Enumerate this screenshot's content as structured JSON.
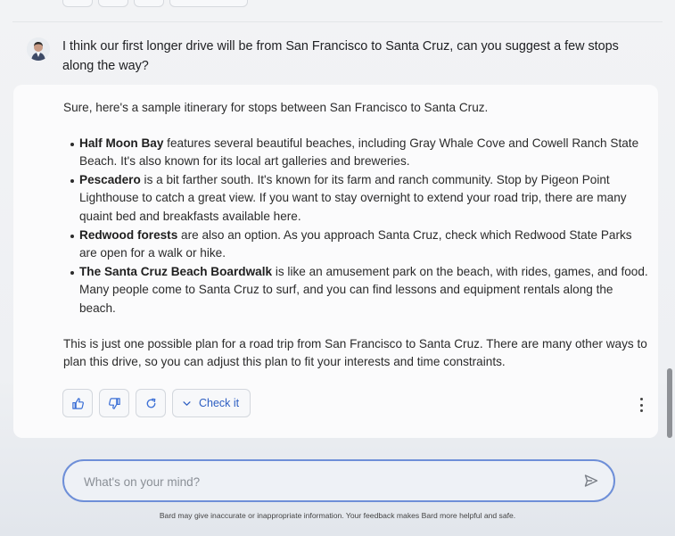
{
  "user_message": {
    "text": "I think our first longer drive will be from San Francisco to Santa Cruz, can you suggest a few stops along the way?"
  },
  "response": {
    "intro": "Sure, here's a sample itinerary for stops between San Francisco to Santa Cruz.",
    "items": [
      {
        "title": "Half Moon Bay",
        "text": " features several beautiful beaches, including Gray Whale Cove and Cowell Ranch State Beach. It's also known for its local art galleries and breweries."
      },
      {
        "title": "Pescadero",
        "text": " is a bit farther south. It's known for its farm and ranch community. Stop by Pigeon Point Lighthouse to catch a great view. If you want to stay overnight to extend your road trip, there are many quaint bed and breakfasts available here."
      },
      {
        "title": "Redwood forests",
        "text": " are also an option. As you approach Santa Cruz, check which Redwood State Parks are open for a walk or hike."
      },
      {
        "title": "The Santa Cruz Beach Boardwalk",
        "text": " is like an amusement park on the beach, with rides, games, and food. Many people come to Santa Cruz to surf, and you can find lessons and equipment rentals along the beach."
      }
    ],
    "outro": "This is just one possible plan for a road trip from San Francisco to Santa Cruz. There are many other ways to plan this drive, so you can adjust this plan to fit your interests and time constraints."
  },
  "actions": {
    "check_label": "Check it",
    "icons": [
      "thumbs-up-icon",
      "thumbs-down-icon",
      "regenerate-icon",
      "chevron-down-icon",
      "more-vertical-icon"
    ]
  },
  "input": {
    "placeholder": "What's on your mind?",
    "value": ""
  },
  "disclaimer": "Bard may give inaccurate or inappropriate information. Your feedback makes Bard more helpful and safe.",
  "colors": {
    "accent": "#3b6fd6",
    "input_border": "#6e8fd8",
    "background": "#f2f3f5"
  }
}
